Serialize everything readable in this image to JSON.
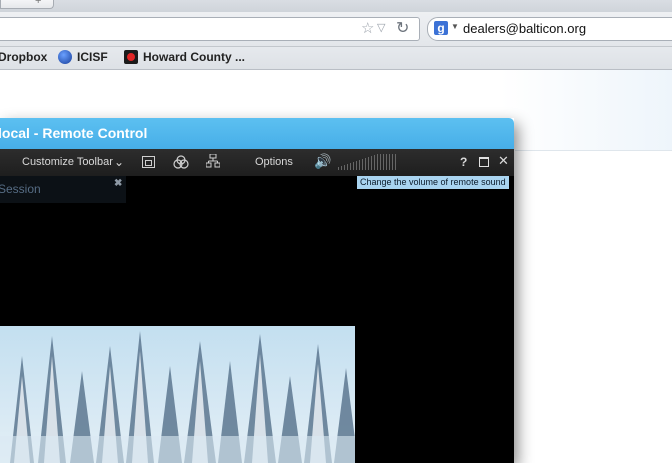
{
  "browser": {
    "tab_new_label": "+",
    "search": {
      "engine_icon": "google-icon",
      "value": "dealers@balticon.org"
    },
    "bookmarks": [
      {
        "label": "Dropbox",
        "icon": "none"
      },
      {
        "label": "ICISF",
        "icon": "globe-icon"
      },
      {
        "label": "Howard County ...",
        "icon": "howard-county-icon"
      }
    ]
  },
  "remote": {
    "title": "local - Remote Control",
    "toolbar": {
      "customize_label": "Customize Toolbar",
      "options_label": "Options",
      "help_label": "?"
    },
    "session_label": "Session",
    "tooltip": "Change the volume of remote sound"
  },
  "colors": {
    "titlebar": "#4fb6ec",
    "toolbar": "#262626",
    "tooltip": "#a9d4f0"
  }
}
